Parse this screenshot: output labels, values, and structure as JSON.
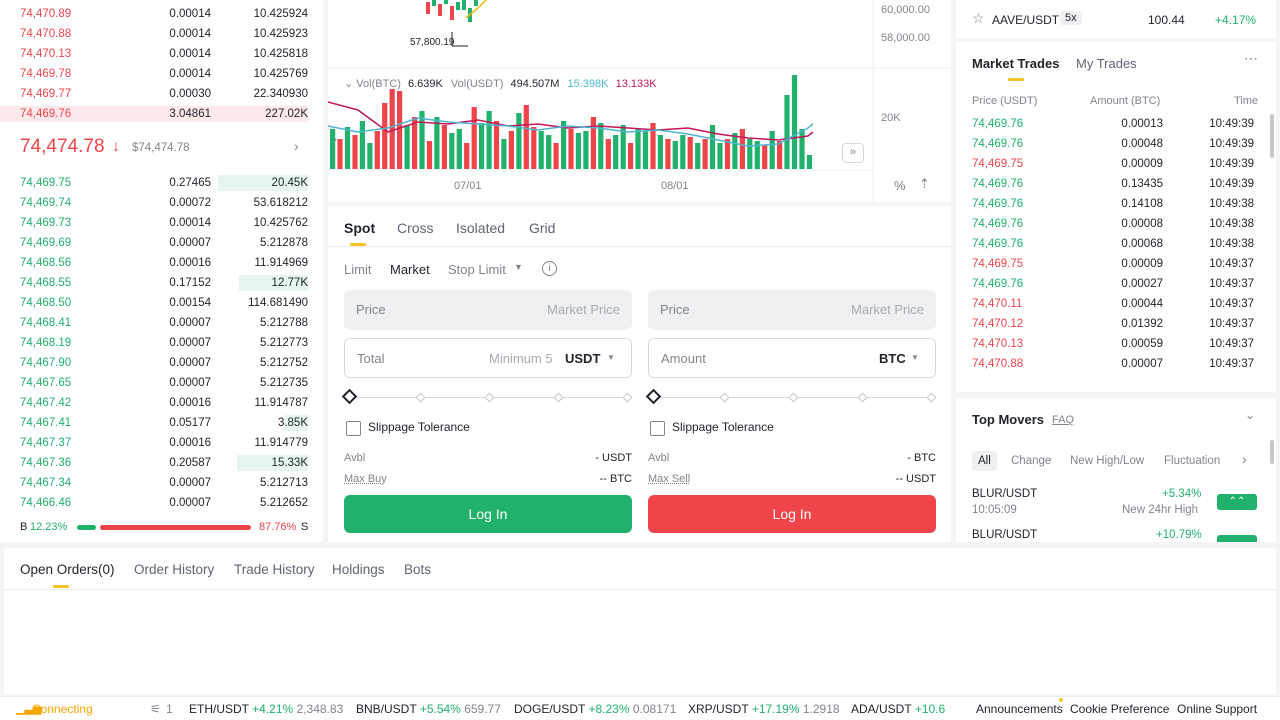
{
  "orderbook": {
    "asks": [
      {
        "price": "74,470.89",
        "amount": "0.00014",
        "total": "10.425924"
      },
      {
        "price": "74,470.88",
        "amount": "0.00014",
        "total": "10.425923"
      },
      {
        "price": "74,470.13",
        "amount": "0.00014",
        "total": "10.425818"
      },
      {
        "price": "74,469.78",
        "amount": "0.00014",
        "total": "10.425769"
      },
      {
        "price": "74,469.77",
        "amount": "0.00030",
        "total": "22.340930"
      },
      {
        "price": "74,469.76",
        "amount": "3.04861",
        "total": "227.02K"
      }
    ],
    "ask_depth": [
      0.02,
      0.02,
      0.02,
      0.02,
      0.04,
      1.0
    ],
    "last_price": "74,474.78",
    "last_price_arrow": "↓",
    "last_price_usd": "$74,474.78",
    "bids": [
      {
        "price": "74,469.75",
        "amount": "0.27465",
        "total": "20.45K"
      },
      {
        "price": "74,469.74",
        "amount": "0.00072",
        "total": "53.618212"
      },
      {
        "price": "74,469.73",
        "amount": "0.00014",
        "total": "10.425762"
      },
      {
        "price": "74,469.69",
        "amount": "0.00007",
        "total": "5.212878"
      },
      {
        "price": "74,468.56",
        "amount": "0.00016",
        "total": "11.914969"
      },
      {
        "price": "74,468.55",
        "amount": "0.17152",
        "total": "12.77K"
      },
      {
        "price": "74,468.50",
        "amount": "0.00154",
        "total": "114.681490"
      },
      {
        "price": "74,468.41",
        "amount": "0.00007",
        "total": "5.212788"
      },
      {
        "price": "74,468.19",
        "amount": "0.00007",
        "total": "5.212773"
      },
      {
        "price": "74,467.90",
        "amount": "0.00007",
        "total": "5.212752"
      },
      {
        "price": "74,467.65",
        "amount": "0.00007",
        "total": "5.212735"
      },
      {
        "price": "74,467.42",
        "amount": "0.00016",
        "total": "11.914787"
      },
      {
        "price": "74,467.41",
        "amount": "0.05177",
        "total": "3.85K"
      },
      {
        "price": "74,467.37",
        "amount": "0.00016",
        "total": "11.914779"
      },
      {
        "price": "74,467.36",
        "amount": "0.20587",
        "total": "15.33K"
      },
      {
        "price": "74,467.34",
        "amount": "0.00007",
        "total": "5.212713"
      },
      {
        "price": "74,466.46",
        "amount": "0.00007",
        "total": "5.212652"
      }
    ],
    "bid_depth": [
      0.39,
      0,
      0,
      0,
      0,
      0.3,
      0,
      0,
      0,
      0,
      0,
      0,
      0.1,
      0,
      0.31,
      0,
      0
    ],
    "buy_label": "B",
    "buy_pct": "12.23%",
    "buy_ratio": 0.1223,
    "sell_pct": "87.76%",
    "sell_label": "S"
  },
  "chart": {
    "low_label": "57,800.19",
    "price_ticks": [
      "60,000.00",
      "58,000.00"
    ],
    "vol_btc_label": "Vol(BTC)",
    "vol_btc": "6.639K",
    "vol_usdt_label": "Vol(USDT)",
    "vol_usdt": "494.507M",
    "ma1": "15.398K",
    "ma2": "13.133K",
    "vol_tick": "20K",
    "dates": [
      "07/01",
      "08/01"
    ],
    "percent_label": "%"
  },
  "trade": {
    "mode_tabs": [
      "Spot",
      "Cross",
      "Isolated",
      "Grid"
    ],
    "order_types": [
      "Limit",
      "Market",
      "Stop Limit"
    ],
    "buy": {
      "price_label": "Price",
      "price_placeholder": "Market Price",
      "total_label": "Total",
      "total_placeholder": "Minimum 5",
      "currency": "USDT",
      "slippage": "Slippage Tolerance",
      "avbl_label": "Avbl",
      "avbl_value": "- USDT",
      "max_label": "Max Buy",
      "max_value": "-- BTC",
      "button": "Log In"
    },
    "sell": {
      "price_label": "Price",
      "price_placeholder": "Market Price",
      "amount_label": "Amount",
      "currency": "BTC",
      "slippage": "Slippage Tolerance",
      "avbl_label": "Avbl",
      "avbl_value": "- BTC",
      "max_label": "Max Sell",
      "max_value": "-- USDT",
      "button": "Log In"
    },
    "colors": {
      "buy": "#20b26c",
      "sell": "#ef454a",
      "accent": "#f7c324"
    }
  },
  "topright": {
    "pair": "AAVE/USDT",
    "leverage": "5x",
    "price": "100.44",
    "change": "+4.17%"
  },
  "trades": {
    "tabs": [
      "Market Trades",
      "My Trades"
    ],
    "headers": [
      "Price (USDT)",
      "Amount (BTC)",
      "Time"
    ],
    "rows": [
      {
        "price": "74,469.76",
        "amount": "0.00013",
        "time": "10:49:39",
        "side": "buy"
      },
      {
        "price": "74,469.76",
        "amount": "0.00048",
        "time": "10:49:39",
        "side": "buy"
      },
      {
        "price": "74,469.75",
        "amount": "0.00009",
        "time": "10:49:39",
        "side": "sell"
      },
      {
        "price": "74,469.76",
        "amount": "0.13435",
        "time": "10:49:39",
        "side": "buy"
      },
      {
        "price": "74,469.76",
        "amount": "0.14108",
        "time": "10:49:38",
        "side": "buy"
      },
      {
        "price": "74,469.76",
        "amount": "0.00008",
        "time": "10:49:38",
        "side": "buy"
      },
      {
        "price": "74,469.76",
        "amount": "0.00068",
        "time": "10:49:38",
        "side": "buy"
      },
      {
        "price": "74,469.75",
        "amount": "0.00009",
        "time": "10:49:37",
        "side": "sell"
      },
      {
        "price": "74,469.76",
        "amount": "0.00027",
        "time": "10:49:37",
        "side": "buy"
      },
      {
        "price": "74,470.11",
        "amount": "0.00044",
        "time": "10:49:37",
        "side": "sell"
      },
      {
        "price": "74,470.12",
        "amount": "0.01392",
        "time": "10:49:37",
        "side": "sell"
      },
      {
        "price": "74,470.13",
        "amount": "0.00059",
        "time": "10:49:37",
        "side": "sell"
      },
      {
        "price": "74,470.88",
        "amount": "0.00007",
        "time": "10:49:37",
        "side": "sell"
      }
    ]
  },
  "movers": {
    "title": "Top Movers",
    "faq": "FAQ",
    "filters": [
      "All",
      "Change",
      "New High/Low",
      "Fluctuation"
    ],
    "items": [
      {
        "pair": "BLUR/USDT",
        "change": "+5.34%",
        "time": "10:05:09",
        "event": "New 24hr High"
      },
      {
        "pair": "BLUR/USDT",
        "change": "+10.79%",
        "time": "",
        "event": ""
      }
    ]
  },
  "orders": {
    "tabs": [
      "Open Orders(0)",
      "Order History",
      "Trade History",
      "Holdings",
      "Bots"
    ]
  },
  "ticker": {
    "status": "Connecting",
    "count": "1",
    "items": [
      {
        "pair": "ETH/USDT",
        "change": "+4.21%",
        "price": "2,348.83"
      },
      {
        "pair": "BNB/USDT",
        "change": "+5.54%",
        "price": "659.77"
      },
      {
        "pair": "DOGE/USDT",
        "change": "+8.23%",
        "price": "0.08171"
      },
      {
        "pair": "XRP/USDT",
        "change": "+17.19%",
        "price": "1.2918"
      },
      {
        "pair": "ADA/USDT",
        "change": "+10.6",
        "price": ""
      }
    ],
    "links": [
      "Announcements",
      "Cookie Preference",
      "Online Support"
    ]
  }
}
